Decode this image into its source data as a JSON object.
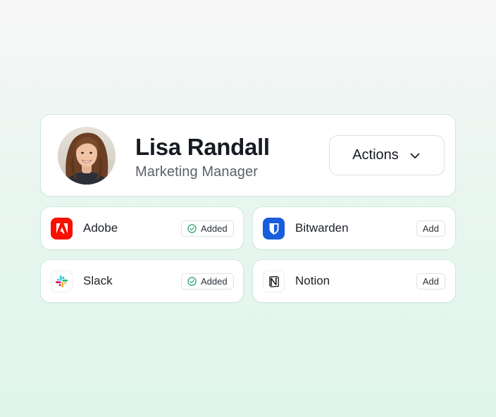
{
  "profile": {
    "name": "Lisa Randall",
    "role": "Marketing Manager",
    "actions_label": "Actions"
  },
  "apps": [
    {
      "name": "Adobe",
      "status": "Added",
      "icon": "adobe-icon",
      "color": "#fa0f00"
    },
    {
      "name": "Bitwarden",
      "status": "Add",
      "icon": "bitwarden-icon",
      "color": "#175ddc"
    },
    {
      "name": "Slack",
      "status": "Added",
      "icon": "slack-icon",
      "color": "#4a154b"
    },
    {
      "name": "Notion",
      "status": "Add",
      "icon": "notion-icon",
      "color": "#000000"
    }
  ],
  "colors": {
    "check": "#22a06b",
    "border": "#cfe9de"
  }
}
